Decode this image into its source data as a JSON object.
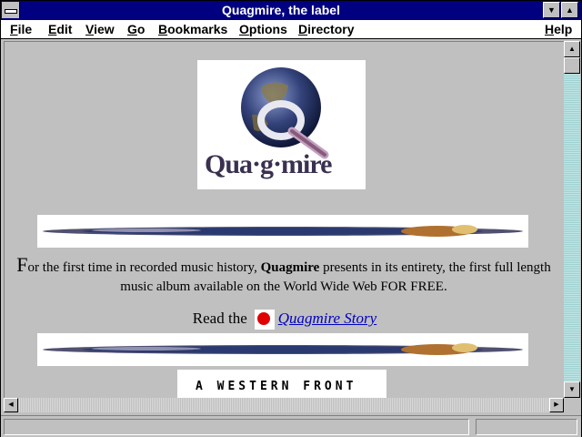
{
  "window": {
    "title": "Quagmire, the label"
  },
  "menu": [
    "File",
    "Edit",
    "View",
    "Go",
    "Bookmarks",
    "Options",
    "Directory",
    "Help"
  ],
  "menu_underline_letters": [
    "F",
    "E",
    "V",
    "G",
    "B",
    "O",
    "D",
    "H"
  ],
  "logo": {
    "text": "Qua·g·mire"
  },
  "intro": {
    "dropcap": "F",
    "part1": "or the first time in recorded music history, ",
    "bold": "Quagmire",
    "part2": " presents in its entirety, the first full length music album available on the World Wide Web FOR FREE."
  },
  "read": {
    "prefix": "Read the",
    "link": "Quagmire Story"
  },
  "front_banner": {
    "text": "A WESTERN FRONT"
  },
  "colors": {
    "titlebar": "#000080",
    "link": "#0000c0",
    "q_icon": "#e00000"
  }
}
